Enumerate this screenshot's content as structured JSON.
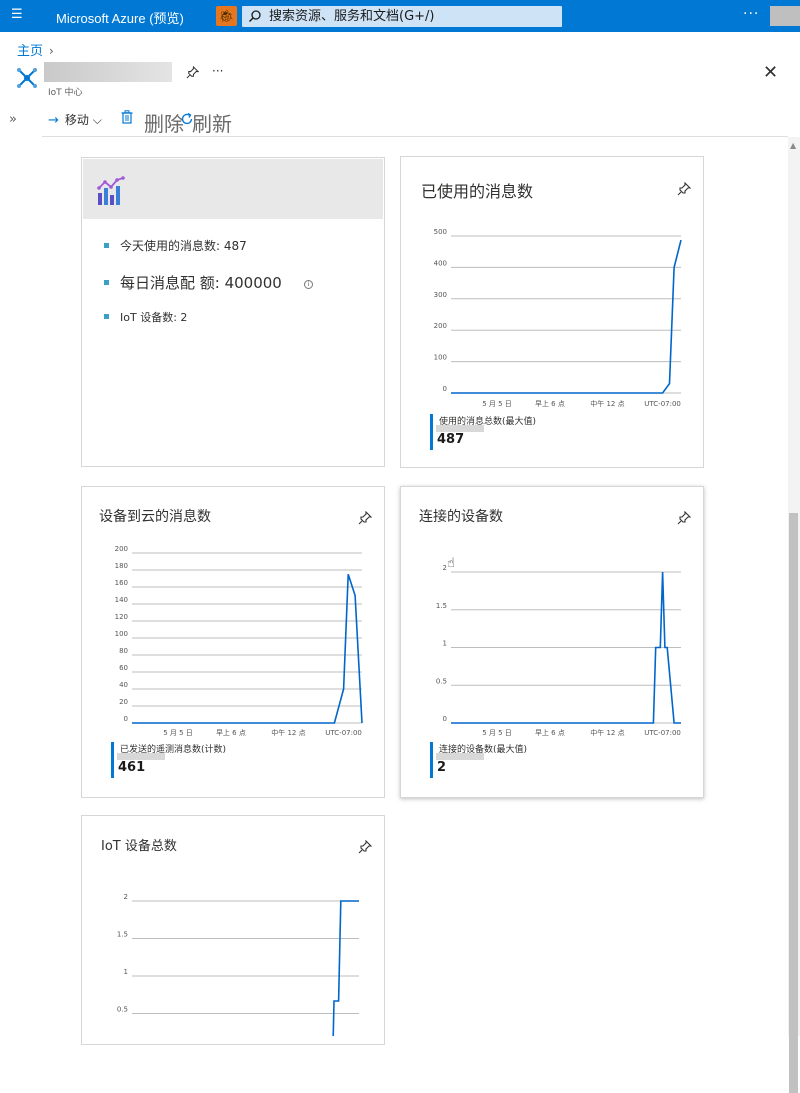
{
  "topbar": {
    "menu_icon": "hamburger-icon",
    "brand": "Microsoft Azure (预览)",
    "feedback_icon": "bug-icon",
    "search_placeholder": "搜索资源、服务和文档(G+/)",
    "more": "···"
  },
  "breadcrumb": {
    "home": "主页",
    "chevron": "›"
  },
  "resource": {
    "type_label": "IoT 中心",
    "more": "···",
    "close": "✕"
  },
  "expander": "»",
  "toolbar": {
    "move": "移动",
    "delete": "删除",
    "refresh": "刷新"
  },
  "colors": {
    "accent": "#0078d4",
    "line": "#0066cc"
  },
  "tiles": {
    "info": {
      "items": [
        "今天使用的消息数: 487",
        "每日消息配 额: 400000",
        "IoT 设备数: 2"
      ]
    },
    "messages_used": {
      "title": "已使用的消息数",
      "legend_label": "使用的消息总数(最大值)",
      "legend_value": "487"
    },
    "d2c": {
      "title": "设备到云的消息数",
      "legend_label": "已发送的遥测消息数(计数)",
      "legend_value": "461"
    },
    "connected": {
      "title": "连接的设备数",
      "legend_label": "连接的设备数(最大值)",
      "legend_value": "2"
    },
    "total": {
      "title": "IoT 设备总数"
    }
  },
  "chart_data": [
    {
      "type": "line",
      "title": "已使用的消息数",
      "yticks": [
        "500",
        "400",
        "300",
        "200",
        "100",
        "0"
      ],
      "ylim": [
        0,
        500
      ],
      "xticks": [
        "5 月 5 日",
        "早上 6 点",
        "中午 12 点",
        "UTC-07:00"
      ],
      "series": [
        {
          "name": "使用的消息总数(最大值)",
          "x": [
            0,
            0.86,
            0.92,
            0.95,
            0.97,
            1.0
          ],
          "values": [
            0,
            0,
            0,
            30,
            400,
            487
          ]
        }
      ]
    },
    {
      "type": "line",
      "title": "设备到云的消息数",
      "yticks": [
        "200",
        "180",
        "160",
        "140",
        "120",
        "100",
        "80",
        "60",
        "40",
        "20",
        "0"
      ],
      "ylim": [
        0,
        200
      ],
      "xticks": [
        "5 月 5 日",
        "早上 6 点",
        "中午 12 点",
        "UTC-07:00"
      ],
      "series": [
        {
          "name": "已发送的遥测消息数(计数)",
          "x": [
            0,
            0.88,
            0.92,
            0.94,
            0.97,
            1.0
          ],
          "values": [
            0,
            0,
            40,
            175,
            150,
            0
          ]
        }
      ]
    },
    {
      "type": "line",
      "title": "连接的设备数",
      "yticks": [
        "2",
        "1.5",
        "1",
        "0.5",
        "0"
      ],
      "ylim": [
        0,
        2
      ],
      "xticks": [
        "5 月 5 日",
        "早上 6 点",
        "中午 12 点",
        "UTC-07:00"
      ],
      "series": [
        {
          "name": "连接的设备数(最大值)",
          "x": [
            0,
            0.88,
            0.89,
            0.91,
            0.92,
            0.93,
            0.94,
            0.97,
            1.0
          ],
          "values": [
            0,
            0,
            1,
            1,
            2,
            1,
            1,
            0,
            0
          ]
        }
      ]
    },
    {
      "type": "line",
      "title": "IoT 设备总数",
      "yticks": [
        "2",
        "1.5",
        "1",
        "0.5"
      ],
      "ylim": [
        0,
        2
      ],
      "series": [
        {
          "name": "IoT 设备总数",
          "x": [
            0,
            0.88,
            0.89,
            0.91,
            0.92,
            0.95,
            1.0
          ],
          "values": [
            0,
            0,
            1,
            1,
            2,
            2,
            2
          ]
        }
      ]
    }
  ]
}
